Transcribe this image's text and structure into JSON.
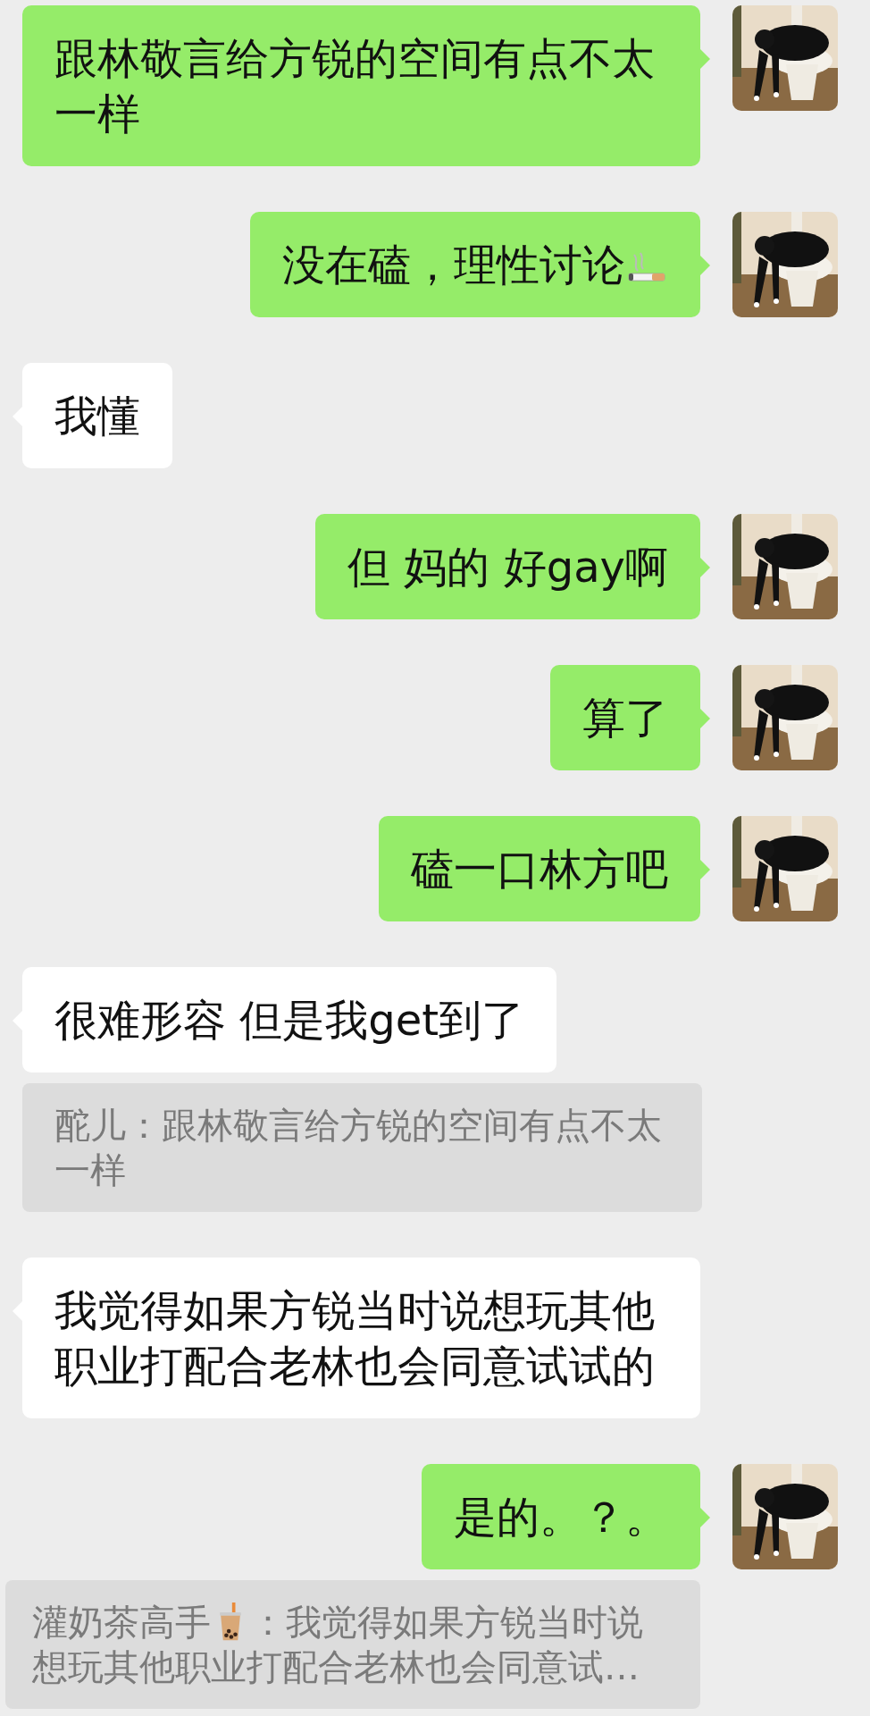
{
  "messages": [
    {
      "kind": "sent",
      "text": "跟林敬言给方锐的空间有点不太一样"
    },
    {
      "kind": "sent",
      "text": "没在磕，理性讨论",
      "cigarette_emoji": true
    },
    {
      "kind": "received",
      "text": "我懂"
    },
    {
      "kind": "sent",
      "text": "但 妈的 好gay啊"
    },
    {
      "kind": "sent",
      "text": "算了"
    },
    {
      "kind": "sent",
      "text": "磕一口林方吧"
    },
    {
      "kind": "received",
      "text": "很难形容 但是我get到了"
    },
    {
      "kind": "quote",
      "sender": "酡儿",
      "lines": [
        "：跟林敬言给方锐的空间有点不太",
        "一样"
      ]
    },
    {
      "kind": "received",
      "text": "我觉得如果方锐当时说想玩其他职业打配合老林也会同意试试的"
    },
    {
      "kind": "sent",
      "text": "是的。？。"
    },
    {
      "kind": "quote",
      "sender": "灌奶茶高手",
      "tea_emoji": true,
      "lines": [
        "：我觉得如果方锐当时说",
        "想玩其他职业打配合老林也会同意试…"
      ],
      "wide": true
    }
  ]
}
